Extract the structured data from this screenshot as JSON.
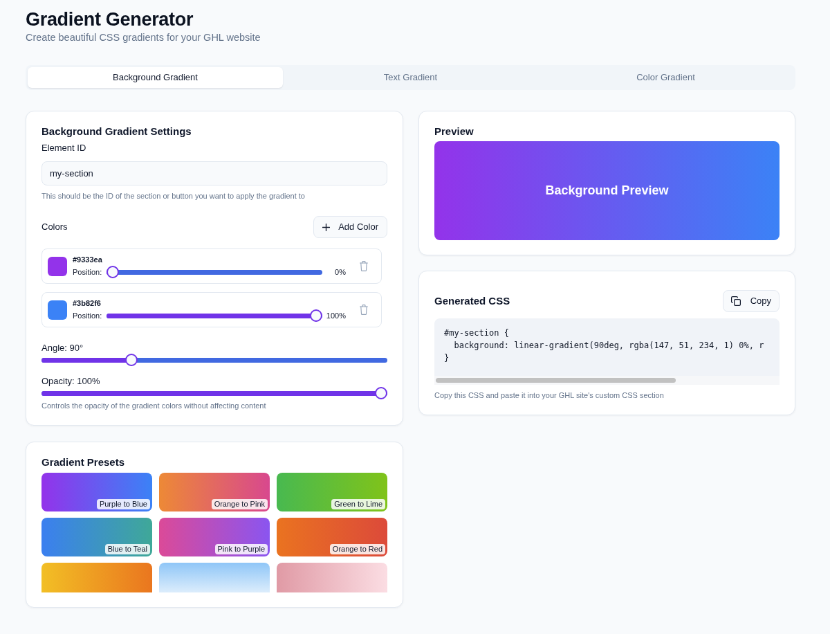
{
  "header": {
    "title": "Gradient Generator",
    "subtitle": "Create beautiful CSS gradients for your GHL website"
  },
  "tabs": [
    {
      "label": "Background Gradient",
      "selected": true
    },
    {
      "label": "Text Gradient",
      "selected": false
    },
    {
      "label": "Color Gradient",
      "selected": false
    }
  ],
  "settings": {
    "title": "Background Gradient Settings",
    "element_id": {
      "label": "Element ID",
      "value": "my-section",
      "help": "This should be the ID of the section or button you want to apply the gradient to"
    },
    "colors_label": "Colors",
    "add_button": "Add Color",
    "colors": [
      {
        "hex": "#9333ea",
        "color": "#9333ea",
        "position_label": "Position:",
        "level": 0,
        "reading": "0%"
      },
      {
        "hex": "#3b82f6",
        "color": "#3b82f6",
        "position_label": "Position:",
        "level": 1,
        "reading": "100%"
      }
    ],
    "angle": {
      "label": "Angle: 90°",
      "level": 0.25
    },
    "opacity": {
      "label": "Opacity: 100%",
      "level": 1,
      "help": "Controls the opacity of the gradient colors without affecting content"
    }
  },
  "presets": {
    "title": "Gradient Presets",
    "items": [
      {
        "label": "Purple to Blue",
        "kind": "horizontal",
        "stops": [
          {
            "color": "#9333ea"
          },
          {
            "color": "#3b82f6"
          }
        ]
      },
      {
        "label": "Orange to Pink",
        "kind": "horizontal",
        "stops": [
          {
            "color": "#ed8936"
          },
          {
            "color": "#d8488e"
          }
        ]
      },
      {
        "label": "Green to Lime",
        "kind": "horizontal",
        "stops": [
          {
            "color": "#48b950"
          },
          {
            "color": "#80c31a"
          }
        ]
      },
      {
        "label": "Blue to Teal",
        "kind": "horizontal",
        "stops": [
          {
            "color": "#3b7ff0"
          },
          {
            "color": "#3fa898"
          }
        ]
      },
      {
        "label": "Pink to Purple",
        "kind": "horizontal",
        "stops": [
          {
            "color": "#db4a98"
          },
          {
            "color": "#8a55f0"
          }
        ]
      },
      {
        "label": "Orange to Red",
        "kind": "horizontal",
        "stops": [
          {
            "color": "#ea7320"
          },
          {
            "color": "#dc4a3a"
          }
        ]
      },
      {
        "kind": "horizontal",
        "stops": [
          {
            "color": "#f2bf25"
          },
          {
            "color": "#ea761f"
          }
        ]
      },
      {
        "kind": "vertical",
        "stops": [
          {
            "color": "#8fc6f7"
          },
          {
            "color": "#dcedfc"
          }
        ]
      },
      {
        "kind": "horizontal",
        "stops": [
          {
            "color": "#e09aa5"
          },
          {
            "color": "#fbdde3"
          }
        ]
      }
    ]
  },
  "preview": {
    "title": "Preview",
    "text": "Background Preview"
  },
  "css": {
    "title": "Generated CSS",
    "copy_button": "Copy",
    "code_lines": [
      "#my-section {",
      "  background: linear-gradient(90deg, rgba(147, 51, 234, 1) 0%, r",
      "}"
    ],
    "help": "Copy this CSS and paste it into your GHL site's custom CSS section"
  }
}
